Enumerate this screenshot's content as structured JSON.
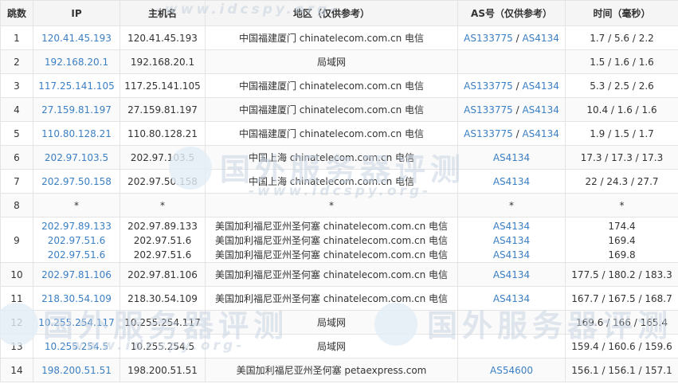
{
  "headers": {
    "hop": "跳数",
    "ip": "IP",
    "host": "主机名",
    "region": "地区（仅供参考）",
    "as": "AS号（仅供参考）",
    "time": "时间（毫秒）"
  },
  "watermark": {
    "title": "国外服务器评测",
    "url": "-www.idcspy.org-"
  },
  "rows": [
    {
      "hop": "1",
      "lines": [
        {
          "ip": "120.41.45.193",
          "host": "120.41.45.193",
          "region": "中国福建厦门 chinatelecom.com.cn 电信",
          "as1": "AS133775",
          "sep": " / ",
          "as2": "AS4134"
        }
      ],
      "time": "1.7 / 5.6 / 2.2"
    },
    {
      "hop": "2",
      "lines": [
        {
          "ip": "192.168.20.1",
          "host": "192.168.20.1",
          "region": "局域网",
          "as1": "",
          "sep": "",
          "as2": ""
        }
      ],
      "time": "1.5 / 1.6 / 1.6"
    },
    {
      "hop": "3",
      "lines": [
        {
          "ip": "117.25.141.105",
          "host": "117.25.141.105",
          "region": "中国福建厦门 chinatelecom.com.cn 电信",
          "as1": "AS133775",
          "sep": " / ",
          "as2": "AS4134"
        }
      ],
      "time": "5.3 / 2.5 / 2.6"
    },
    {
      "hop": "4",
      "lines": [
        {
          "ip": "27.159.81.197",
          "host": "27.159.81.197",
          "region": "中国福建厦门 chinatelecom.com.cn 电信",
          "as1": "AS133775",
          "sep": " / ",
          "as2": "AS4134"
        }
      ],
      "time": "10.4 / 1.6 / 1.6"
    },
    {
      "hop": "5",
      "lines": [
        {
          "ip": "110.80.128.21",
          "host": "110.80.128.21",
          "region": "中国福建厦门 chinatelecom.com.cn 电信",
          "as1": "AS133775",
          "sep": " / ",
          "as2": "AS4134"
        }
      ],
      "time": "1.9 / 1.5 / 1.7"
    },
    {
      "hop": "6",
      "lines": [
        {
          "ip": "202.97.103.5",
          "host": "202.97.103.5",
          "region": "中国上海 chinatelecom.com.cn 电信",
          "as1": "AS4134",
          "sep": "",
          "as2": ""
        }
      ],
      "time": "17.3 / 17.3 / 17.3"
    },
    {
      "hop": "7",
      "lines": [
        {
          "ip": "202.97.50.158",
          "host": "202.97.50.158",
          "region": "中国上海 chinatelecom.com.cn 电信",
          "as1": "AS4134",
          "sep": "",
          "as2": ""
        }
      ],
      "time": "22 / 24.3 / 27.7"
    },
    {
      "hop": "8",
      "lines": [
        {
          "ip": "*",
          "host": "*",
          "region": "*",
          "as1": "*",
          "sep": "",
          "as2": ""
        }
      ],
      "time": "*",
      "plain": true
    },
    {
      "hop": "9",
      "multi": true,
      "lines": [
        {
          "ip": "202.97.89.133",
          "host": "202.97.89.133",
          "region": "美国加利福尼亚州圣何塞 chinatelecom.com.cn 电信",
          "as1": "AS4134",
          "sep": "",
          "as2": "",
          "time": "174.4"
        },
        {
          "ip": "202.97.51.6",
          "host": "202.97.51.6",
          "region": "美国加利福尼亚州圣何塞 chinatelecom.com.cn 电信",
          "as1": "AS4134",
          "sep": "",
          "as2": "",
          "time": "169.4"
        },
        {
          "ip": "202.97.51.6",
          "host": "202.97.51.6",
          "region": "美国加利福尼亚州圣何塞 chinatelecom.com.cn 电信",
          "as1": "AS4134",
          "sep": "",
          "as2": "",
          "time": "169.8"
        }
      ]
    },
    {
      "hop": "10",
      "lines": [
        {
          "ip": "202.97.81.106",
          "host": "202.97.81.106",
          "region": "美国加利福尼亚州圣何塞 chinatelecom.com.cn 电信",
          "as1": "AS4134",
          "sep": "",
          "as2": ""
        }
      ],
      "time": "177.5 / 180.2 / 183.3"
    },
    {
      "hop": "11",
      "lines": [
        {
          "ip": "218.30.54.109",
          "host": "218.30.54.109",
          "region": "美国加利福尼亚州圣何塞 chinatelecom.com.cn 电信",
          "as1": "AS4134",
          "sep": "",
          "as2": ""
        }
      ],
      "time": "167.7 / 167.5 / 168.7"
    },
    {
      "hop": "12",
      "lines": [
        {
          "ip": "10.255.254.117",
          "host": "10.255.254.117",
          "region": "局域网",
          "as1": "",
          "sep": "",
          "as2": ""
        }
      ],
      "time": "169.6 / 166 / 165.4"
    },
    {
      "hop": "13",
      "lines": [
        {
          "ip": "10.255.254.5",
          "host": "10.255.254.5",
          "region": "局域网",
          "as1": "",
          "sep": "",
          "as2": ""
        }
      ],
      "time": "159.4 / 160.6 / 159.6"
    },
    {
      "hop": "14",
      "lines": [
        {
          "ip": "198.200.51.51",
          "host": "198.200.51.51",
          "region": "美国加利福尼亚州圣何塞 petaexpress.com",
          "as1": "AS54600",
          "sep": "",
          "as2": ""
        }
      ],
      "time": "156.1 / 156.1 / 157.1"
    }
  ]
}
